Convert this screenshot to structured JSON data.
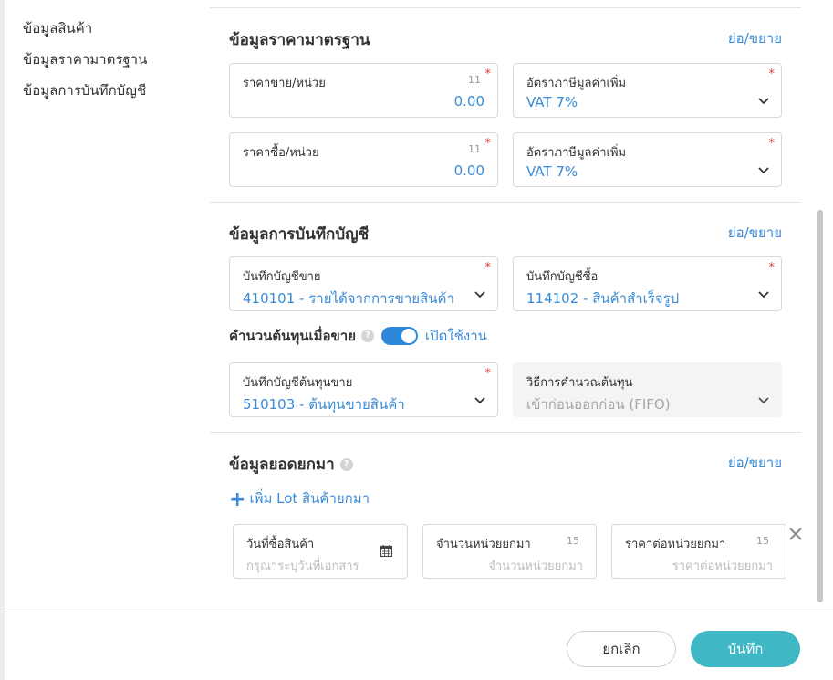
{
  "sidebar": {
    "items": [
      "ข้อมูลสินค้า",
      "ข้อมูลราคามาตรฐาน",
      "ข้อมูลการบันทึกบัญชี"
    ]
  },
  "price_section": {
    "title": "ข้อมูลราคามาตรฐาน",
    "collapse": "ย่อ/ขยาย",
    "sell_price": {
      "label": "ราคาขาย/หน่วย",
      "count": "11",
      "required": "*",
      "value": "0.00"
    },
    "sell_vat": {
      "label": "อัตราภาษีมูลค่าเพิ่ม",
      "required": "*",
      "value": "VAT 7%"
    },
    "buy_price": {
      "label": "ราคาซื้อ/หน่วย",
      "count": "11",
      "required": "*",
      "value": "0.00"
    },
    "buy_vat": {
      "label": "อัตราภาษีมูลค่าเพิ่ม",
      "required": "*",
      "value": "VAT 7%"
    }
  },
  "accounting_section": {
    "title": "ข้อมูลการบันทึกบัญชี",
    "collapse": "ย่อ/ขยาย",
    "sales_account": {
      "label": "บันทึกบัญชีขาย",
      "required": "*",
      "value": "410101 - รายได้จากการขายสินค้า"
    },
    "purchase_account": {
      "label": "บันทึกบัญชีซื้อ",
      "required": "*",
      "value": "114102 - สินค้าสำเร็จรูป"
    },
    "cost_toggle": {
      "label": "คำนวนต้นทุนเมื่อขาย",
      "help": "?",
      "state": "เปิดใช้งาน"
    },
    "cost_account": {
      "label": "บันทึกบัญชีต้นทุนขาย",
      "required": "*",
      "value": "510103 - ต้นทุนขายสินค้า"
    },
    "cost_method": {
      "label": "วิธีการคำนวณต้นทุน",
      "value": "เข้าก่อนออกก่อน (FIFO)"
    }
  },
  "opening_section": {
    "title": "ข้อมูลยอดยกมา",
    "help": "?",
    "collapse": "ย่อ/ขยาย",
    "add_lot": "เพิ่ม Lot สินค้ายกมา",
    "purchase_date": {
      "label": "วันที่ซื้อสินค้า",
      "placeholder": "กรุณาระบุวันที่เอกสาร"
    },
    "qty": {
      "label": "จำนวนหน่วยยกมา",
      "count": "15",
      "placeholder": "จำนวนหน่วยยกมา"
    },
    "unit_price": {
      "label": "ราคาต่อหน่วยยกมา",
      "count": "15",
      "placeholder": "ราคาต่อหน่วยยกมา"
    }
  },
  "footer": {
    "cancel": "ยกเลิก",
    "save": "บันทึก"
  },
  "colors": {
    "accent": "#3a8ad6",
    "toggle": "#2f87d9",
    "save_button": "#3fb7c5",
    "required": "#e53935"
  }
}
